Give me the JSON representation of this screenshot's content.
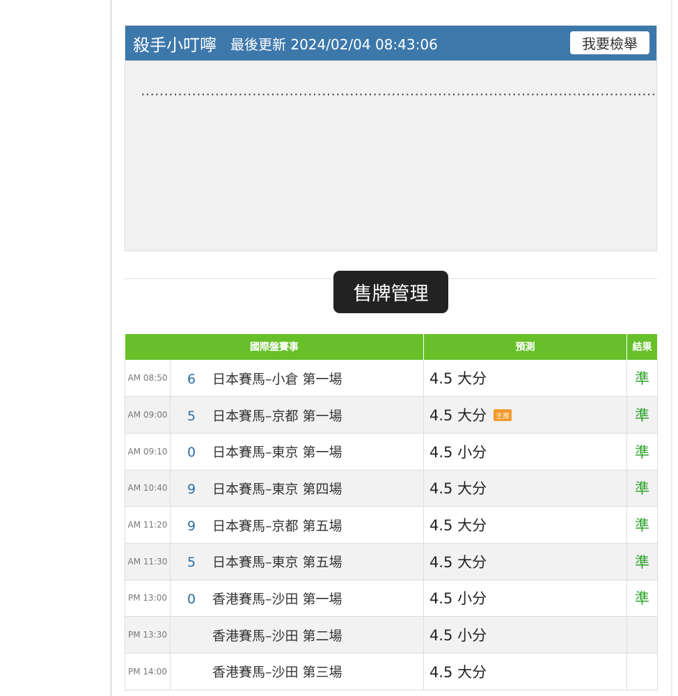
{
  "notice": {
    "title": "殺手小叮嚀",
    "updated": "最後更新 2024/02/04 08:43:06",
    "report_label": "我要檢舉",
    "body": "…………………………………………………………………………………………………………………………………………………………………………………"
  },
  "section": {
    "button_label": "售牌管理"
  },
  "table": {
    "headers": [
      "國際盤賽事",
      "預測",
      "結果"
    ],
    "rows": [
      {
        "time": "AM 08:50",
        "num": "6",
        "event": "日本賽馬–小倉 第一場",
        "prediction": "4.5 大分",
        "tag": "",
        "result": "準"
      },
      {
        "time": "AM 09:00",
        "num": "5",
        "event": "日本賽馬–京都 第一場",
        "prediction": "4.5 大分",
        "tag": "主推",
        "result": "準"
      },
      {
        "time": "AM 09:10",
        "num": "0",
        "event": "日本賽馬–東京 第一場",
        "prediction": "4.5 小分",
        "tag": "",
        "result": "準"
      },
      {
        "time": "AM 10:40",
        "num": "9",
        "event": "日本賽馬–東京 第四場",
        "prediction": "4.5 大分",
        "tag": "",
        "result": "準"
      },
      {
        "time": "AM 11:20",
        "num": "9",
        "event": "日本賽馬–京都 第五場",
        "prediction": "4.5 大分",
        "tag": "",
        "result": "準"
      },
      {
        "time": "AM 11:30",
        "num": "5",
        "event": "日本賽馬–東京 第五場",
        "prediction": "4.5 大分",
        "tag": "",
        "result": "準"
      },
      {
        "time": "PM 13:00",
        "num": "0",
        "event": "香港賽馬–沙田 第一場",
        "prediction": "4.5 小分",
        "tag": "",
        "result": "準"
      },
      {
        "time": "PM 13:30",
        "num": "",
        "event": "香港賽馬–沙田 第二場",
        "prediction": "4.5 小分",
        "tag": "",
        "result": ""
      },
      {
        "time": "PM 14:00",
        "num": "",
        "event": "香港賽馬–沙田 第三場",
        "prediction": "4.5 大分",
        "tag": "",
        "result": ""
      }
    ]
  },
  "colors": {
    "header_blue": "#3d78ab",
    "table_green": "#67c02a",
    "result_green": "#2ea12a",
    "number_blue": "#2c6da3",
    "tag_orange": "#f19a2d"
  }
}
